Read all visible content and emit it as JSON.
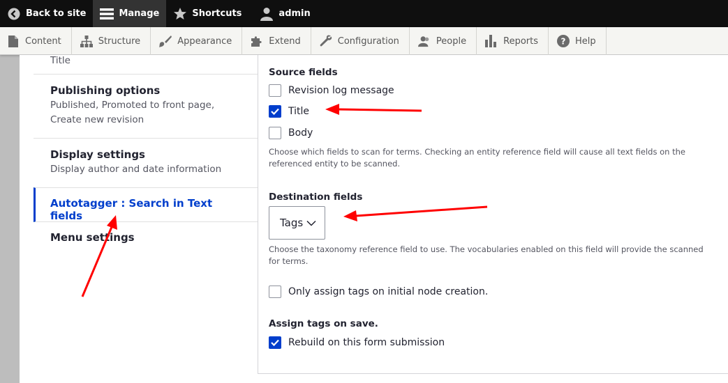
{
  "toolbar": {
    "back_to_site": "Back to site",
    "manage": "Manage",
    "shortcuts": "Shortcuts",
    "user": "admin"
  },
  "tray": {
    "items": [
      "Content",
      "Structure",
      "Appearance",
      "Extend",
      "Configuration",
      "People",
      "Reports",
      "Help"
    ]
  },
  "vertical_tabs": {
    "partial_summary": "Title",
    "publishing": {
      "title": "Publishing options",
      "summary": "Published, Promoted to front page, Create new revision"
    },
    "display": {
      "title": "Display settings",
      "summary": "Display author and date information"
    },
    "autotagger": {
      "title": "Autotagger : Search in Text fields"
    },
    "menu": {
      "title": "Menu settings"
    }
  },
  "form": {
    "source_fields_label": "Source fields",
    "source_options": [
      {
        "label": "Revision log message",
        "checked": false
      },
      {
        "label": "Title",
        "checked": true
      },
      {
        "label": "Body",
        "checked": false
      }
    ],
    "source_description": "Choose which fields to scan for terms. Checking an entity reference field will cause all text fields on the referenced entity to be scanned.",
    "destination_label": "Destination fields",
    "destination_value": "Tags",
    "destination_description": "Choose the taxonomy reference field to use. The vocabularies enabled on this field will provide the scanned for terms.",
    "initial_only_label": "Only assign tags on initial node creation.",
    "initial_only_checked": false,
    "assign_on_save_label": "Assign tags on save.",
    "rebuild_label": "Rebuild on this form submission",
    "rebuild_checked": true
  },
  "colors": {
    "accent": "#003ecc",
    "annotation_arrow": "#ff0000",
    "toolbar_bg": "#0f0f0f"
  }
}
